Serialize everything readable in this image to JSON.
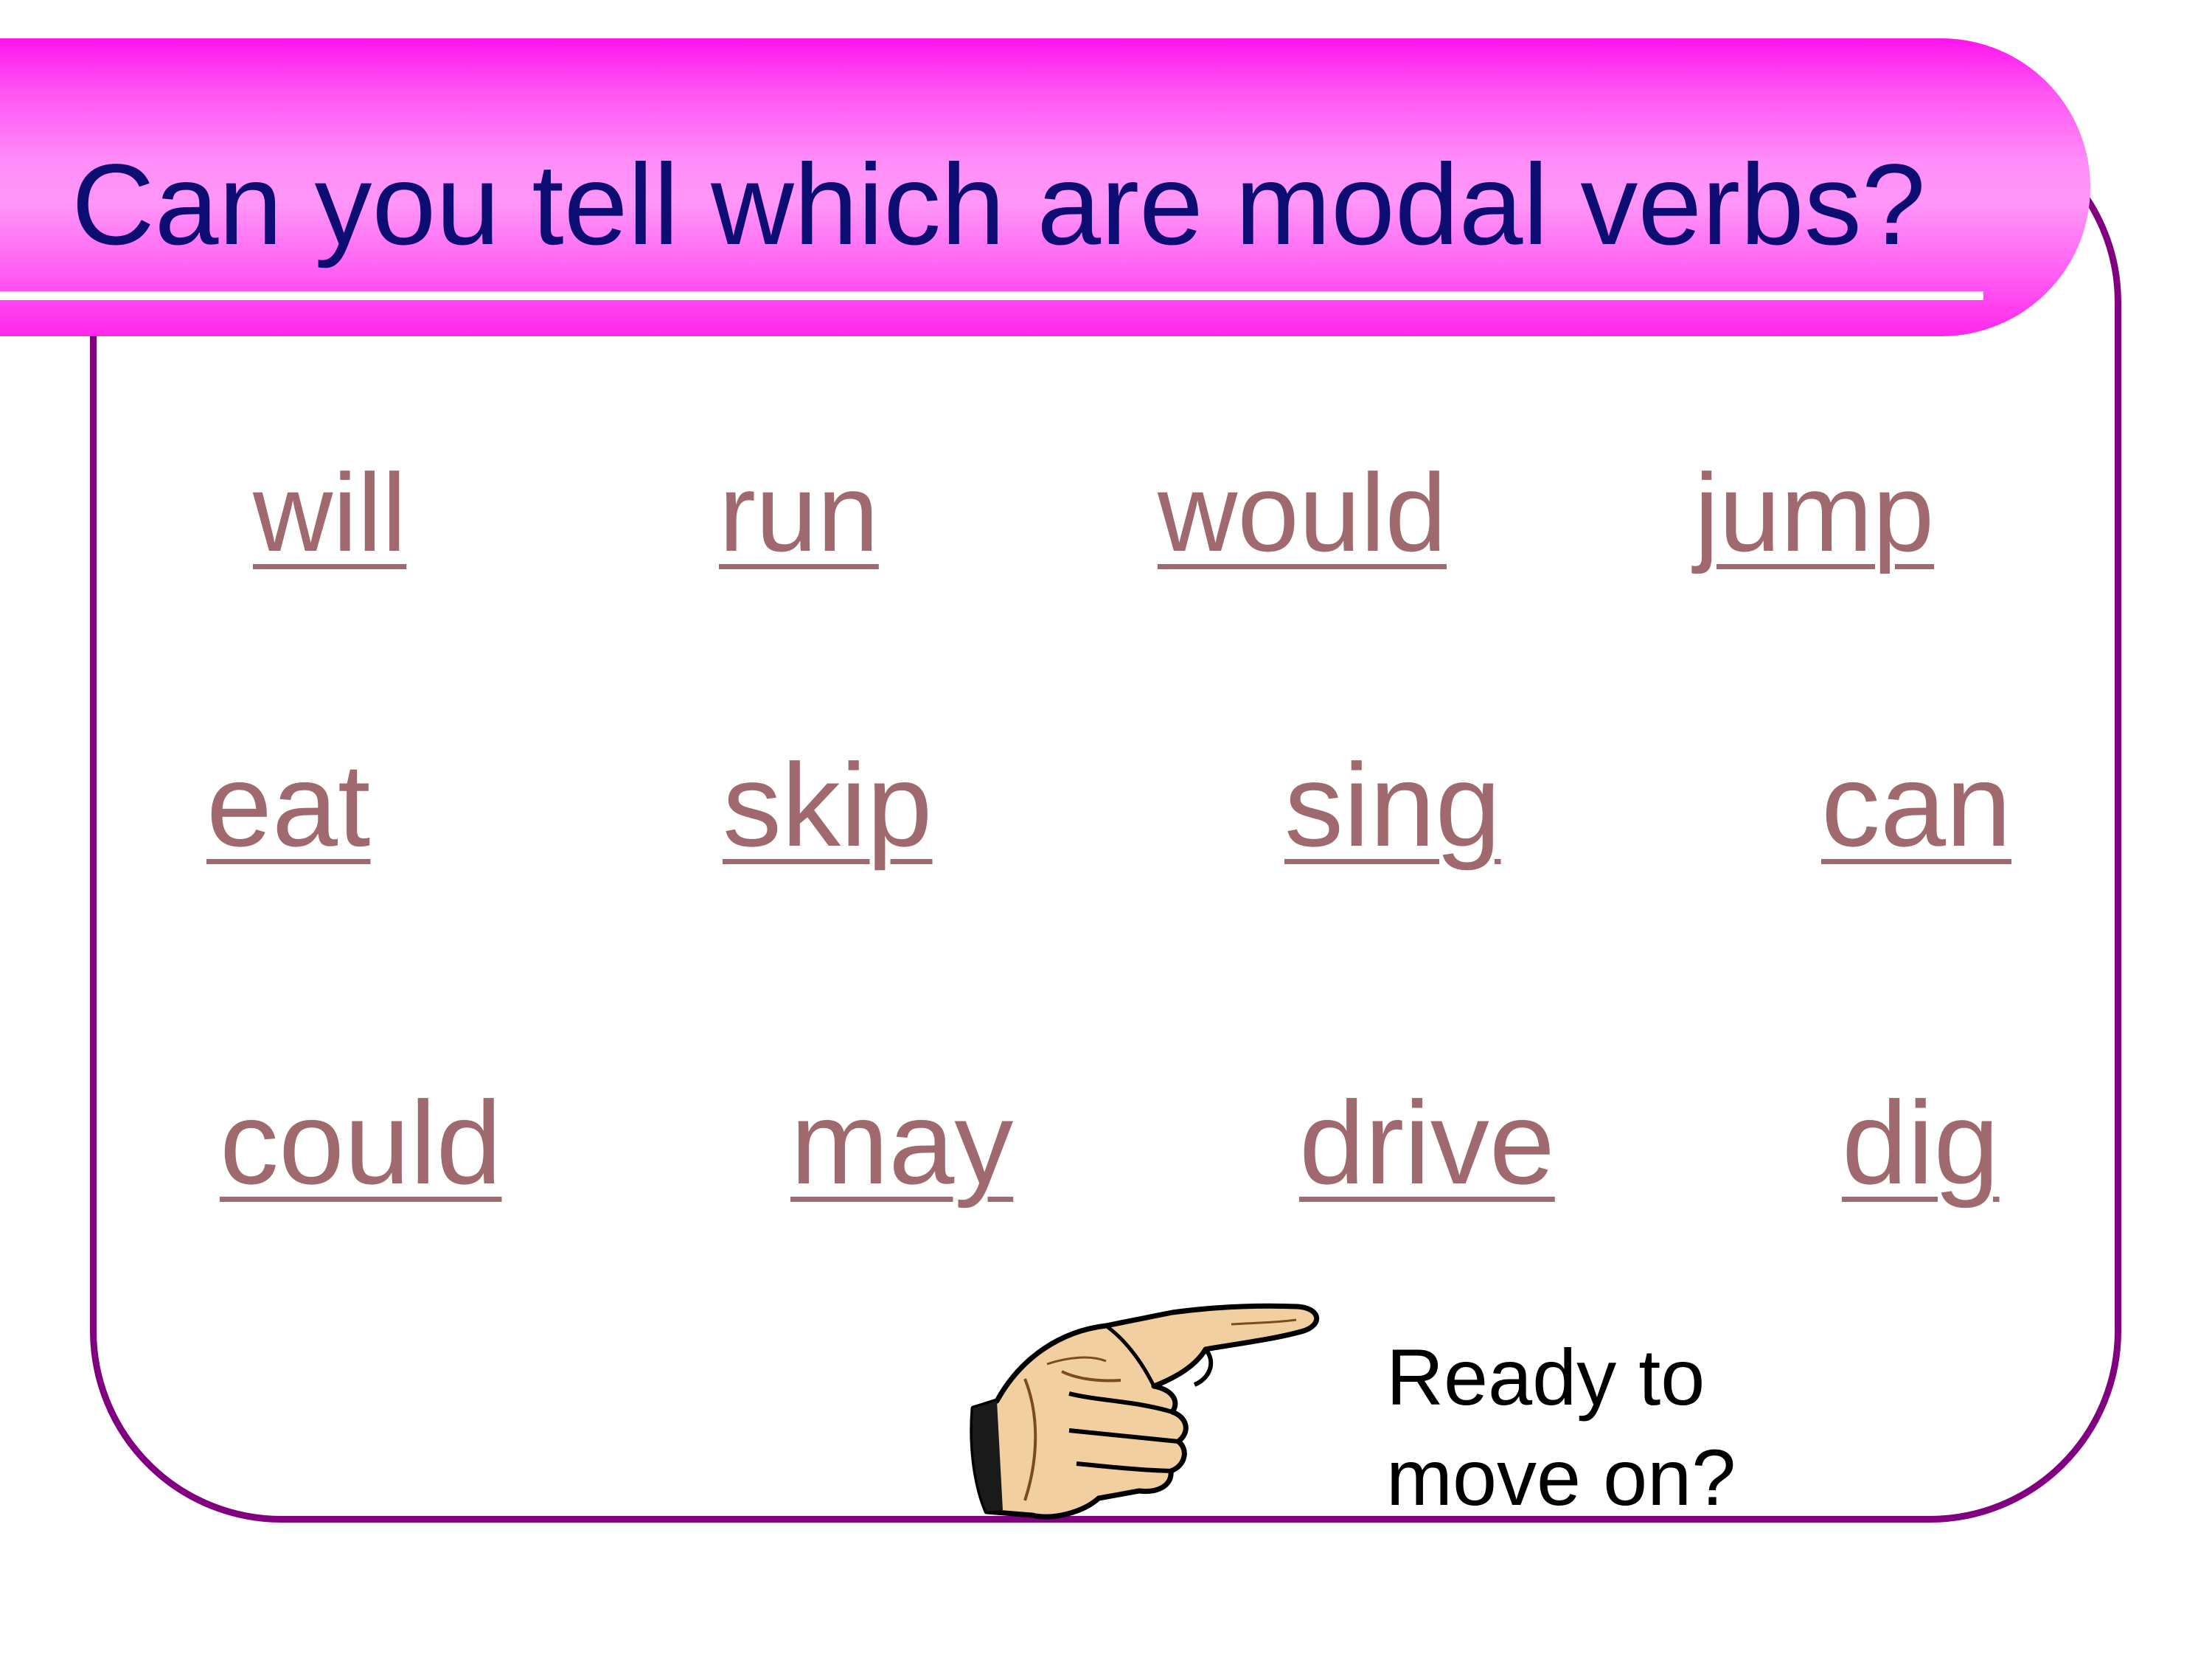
{
  "slide": {
    "title": "Can you tell which are modal verbs?",
    "words": [
      "will",
      "run",
      "would",
      "jump",
      "eat",
      "skip",
      "sing",
      "can",
      "could",
      "may",
      "drive",
      "dig"
    ],
    "next": {
      "line1": "Ready to",
      "line2": "move on?",
      "icon": "pointing-hand-icon"
    }
  },
  "colors": {
    "title_text": "#0d0c73",
    "title_bar": "#ff5cf3",
    "frame_border": "#800080",
    "link_text": "#a0696e"
  }
}
